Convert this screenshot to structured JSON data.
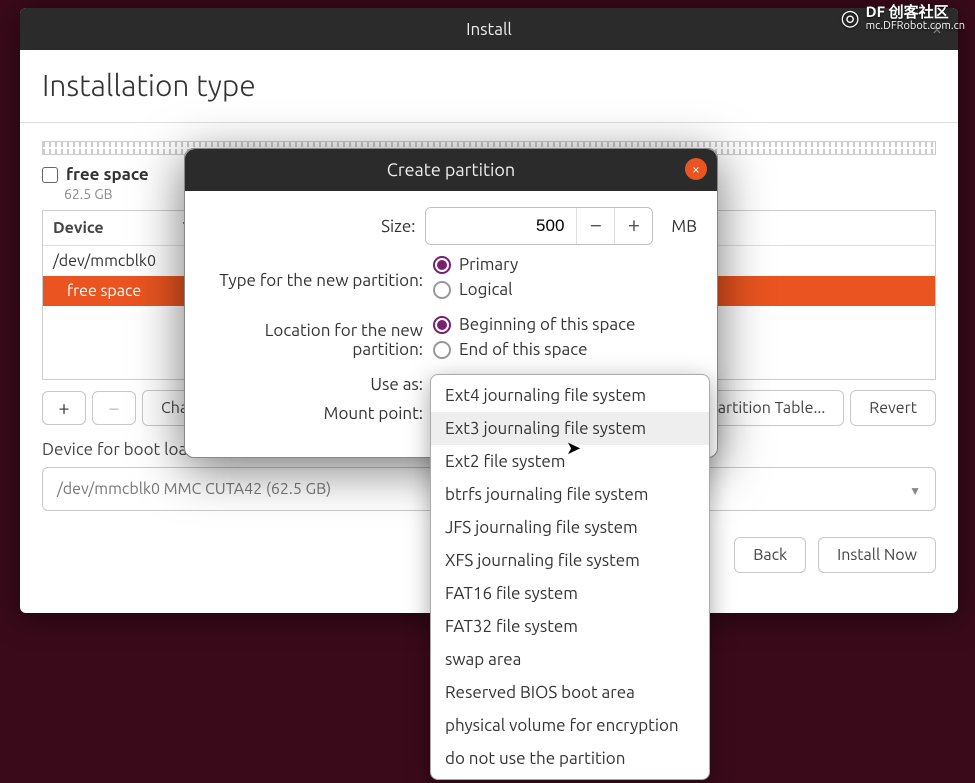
{
  "watermark": {
    "main": "DF 创客社区",
    "sub": "mc.DFRobot.com.cn"
  },
  "main_window": {
    "title": "Install",
    "page_heading": "Installation type",
    "free_space": {
      "label": "free space",
      "size": "62.5 GB"
    },
    "table": {
      "col_device": "Device",
      "col_type": "T",
      "rows": [
        {
          "device": "/dev/mmcblk0",
          "selected": false
        },
        {
          "device": "free space",
          "selected": true
        }
      ]
    },
    "toolbar": {
      "add": "+",
      "remove": "−",
      "change": "Change...",
      "new_table": "New Partition Table...",
      "revert": "Revert"
    },
    "boot_loader": {
      "label": "Device for boot loader installation:",
      "value": "/dev/mmcblk0 MMC CUTA42 (62.5 GB)"
    },
    "footer": {
      "back": "Back",
      "install": "Install Now"
    }
  },
  "modal": {
    "title": "Create partition",
    "size": {
      "label": "Size:",
      "value": "500",
      "unit": "MB"
    },
    "type": {
      "label": "Type for the new partition:",
      "primary": "Primary",
      "logical": "Logical",
      "selected": "Primary"
    },
    "location": {
      "label": "Location for the new partition:",
      "begin": "Beginning of this space",
      "end": "End of this space",
      "selected": "Beginning of this space"
    },
    "use_as": {
      "label": "Use as:"
    },
    "mount_point": {
      "label": "Mount point:"
    }
  },
  "filesystem_dropdown": {
    "hover_index": 1,
    "options": [
      "Ext4 journaling file system",
      "Ext3 journaling file system",
      "Ext2 file system",
      "btrfs journaling file system",
      "JFS journaling file system",
      "XFS journaling file system",
      "FAT16 file system",
      "FAT32 file system",
      "swap area",
      "Reserved BIOS boot area",
      "physical volume for encryption",
      "do not use the partition"
    ]
  }
}
